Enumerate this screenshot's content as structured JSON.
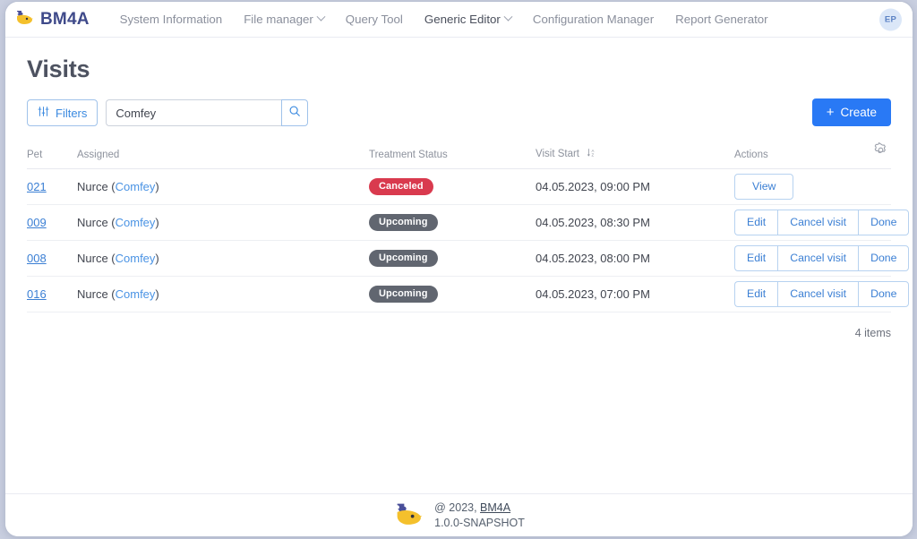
{
  "navbar": {
    "brand": "BM4A",
    "brand_icon": "bm4a-logo-icon",
    "links": [
      {
        "label": "System Information",
        "has_caret": false,
        "active": false
      },
      {
        "label": "File manager",
        "has_caret": true,
        "active": false
      },
      {
        "label": "Query Tool",
        "has_caret": false,
        "active": false
      },
      {
        "label": "Generic Editor",
        "has_caret": true,
        "active": true
      },
      {
        "label": "Configuration Manager",
        "has_caret": false,
        "active": false
      },
      {
        "label": "Report Generator",
        "has_caret": false,
        "active": false
      }
    ],
    "avatar_initials": "EP"
  },
  "page": {
    "title": "Visits"
  },
  "toolbar": {
    "filters_label": "Filters",
    "filters_icon": "sliders-icon",
    "search_value": "Comfey",
    "search_placeholder": "",
    "search_icon": "search-icon",
    "create_label": "Create",
    "create_plus": "+"
  },
  "table": {
    "columns": [
      {
        "key": "pet",
        "label": "Pet"
      },
      {
        "key": "assigned",
        "label": "Assigned"
      },
      {
        "key": "status",
        "label": "Treatment Status"
      },
      {
        "key": "start",
        "label": "Visit Start",
        "sort_icon": "sort-descending-az-icon"
      },
      {
        "key": "actions",
        "label": "Actions"
      }
    ],
    "settings_icon": "gear-icon",
    "rows": [
      {
        "pet": "021",
        "assigned_prefix": "Nurce (",
        "assigned_link": "Comfey",
        "assigned_suffix": ")",
        "status": "Canceled",
        "status_kind": "canceled",
        "start": "04.05.2023, 09:00 PM",
        "actions": [
          "View"
        ]
      },
      {
        "pet": "009",
        "assigned_prefix": "Nurce (",
        "assigned_link": "Comfey",
        "assigned_suffix": ")",
        "status": "Upcoming",
        "status_kind": "upcoming",
        "start": "04.05.2023, 08:30 PM",
        "actions": [
          "Edit",
          "Cancel visit",
          "Done"
        ]
      },
      {
        "pet": "008",
        "assigned_prefix": "Nurce (",
        "assigned_link": "Comfey",
        "assigned_suffix": ")",
        "status": "Upcoming",
        "status_kind": "upcoming",
        "start": "04.05.2023, 08:00 PM",
        "actions": [
          "Edit",
          "Cancel visit",
          "Done"
        ]
      },
      {
        "pet": "016",
        "assigned_prefix": "Nurce (",
        "assigned_link": "Comfey",
        "assigned_suffix": ")",
        "status": "Upcoming",
        "status_kind": "upcoming",
        "start": "04.05.2023, 07:00 PM",
        "actions": [
          "Edit",
          "Cancel visit",
          "Done"
        ]
      }
    ],
    "items_count": "4 items"
  },
  "footer": {
    "logo_icon": "bm4a-logo-icon",
    "copyright": "@ 2023, ",
    "brand": "BM4A",
    "version": "1.0.0-SNAPSHOT"
  },
  "colors": {
    "brand": "#3f4a8a",
    "primary": "#2979f5",
    "link": "#3b7fd4",
    "danger": "#d93a4e",
    "neutral_badge": "#616670"
  }
}
